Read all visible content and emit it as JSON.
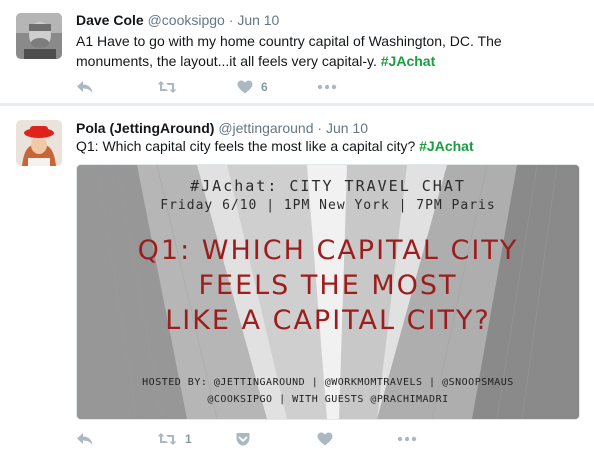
{
  "tweets": [
    {
      "author_name": "Dave Cole",
      "author_handle": "@cooksipgo",
      "separator": "·",
      "time": "Jun 10",
      "text_before": "A1 Have to go with my home country capital of Washington, DC. The monuments, the layout...it all feels very capital-y. ",
      "hashtag": "#JAchat",
      "actions": {
        "reply_icon": "reply-icon",
        "retweet_icon": "retweet-icon",
        "retweet_count": "",
        "like_icon": "heart-icon",
        "like_count": "6",
        "more_icon": "more-dots-icon"
      }
    },
    {
      "author_name": "Pola (JettingAround)",
      "author_handle": "@jettingaround",
      "separator": "·",
      "time": "Jun 10",
      "text_before": "Q1: Which capital city feels the most like a capital city? ",
      "hashtag": "#JAchat",
      "media": {
        "line1": "#JAchat: CITY TRAVEL CHAT",
        "line2": "Friday 6/10 | 1PM New York | 7PM Paris",
        "question_1": "Q1: WHICH CAPITAL CITY",
        "question_2": "FEELS THE MOST",
        "question_3": "LIKE A CAPITAL CITY?",
        "hosted_1": "HOSTED BY: @JETTINGAROUND | @WORKMOMTRAVELS | @SNOOPSMAUS",
        "hosted_2": "@COOKSIPGO | WITH GUESTS @PRACHIMADRI"
      },
      "actions": {
        "reply_icon": "reply-icon",
        "retweet_icon": "retweet-icon",
        "retweet_count": "1",
        "pocket_icon": "pocket-save-icon",
        "like_icon": "heart-icon",
        "like_count": "",
        "more_icon": "more-dots-icon"
      }
    }
  ],
  "colors": {
    "hashtag": "#1a9e3f",
    "muted": "#657786",
    "icon": "#aab8c2",
    "headline_red": "#9c1d1d"
  }
}
